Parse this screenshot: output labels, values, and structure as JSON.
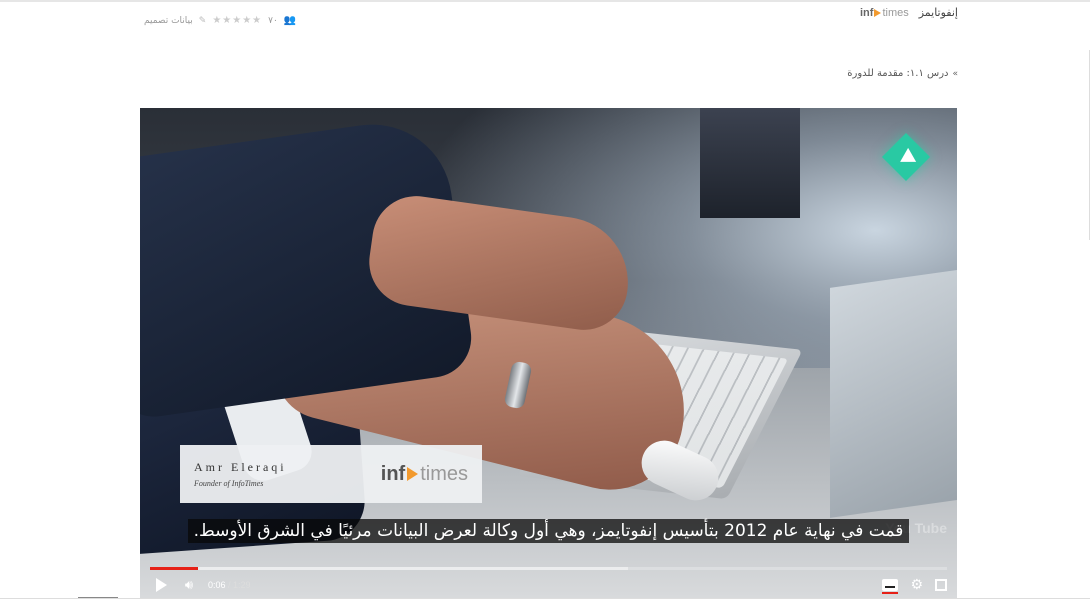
{
  "provider": {
    "logo_inf": "inf",
    "logo_times": "times",
    "name": "إنفوتايمز"
  },
  "course_meta": {
    "enrolled": "٧٠",
    "stars": "★★★★★",
    "category": "بيانات تصميم",
    "icons": [
      "users-icon",
      "star-icon",
      "tag-icon"
    ]
  },
  "lesson": {
    "label": "درس ١.١: مقدمة للدورة",
    "icon": "double-chevron-down-icon"
  },
  "video": {
    "lower_third_name": "Amr Eleraqi",
    "lower_third_title": "Founder of InfoTimes",
    "lower_third_logo_inf": "inf",
    "lower_third_logo_times": "times",
    "watermark": "You Tube",
    "subtitle": "قمت في نهاية عام 2012 بتأسيس إنفوتايمز، وهي أول وكالة لعرض البيانات مرئيًا في الشرق الأوسط.",
    "current_time": "0:06",
    "separator": " / ",
    "duration": "1:29",
    "played_fraction": 0.06,
    "buffered_fraction": 0.6,
    "progress_color": "#e62117",
    "accent_logo_color": "#29c9a3",
    "brand_orange": "#f29a2e"
  }
}
